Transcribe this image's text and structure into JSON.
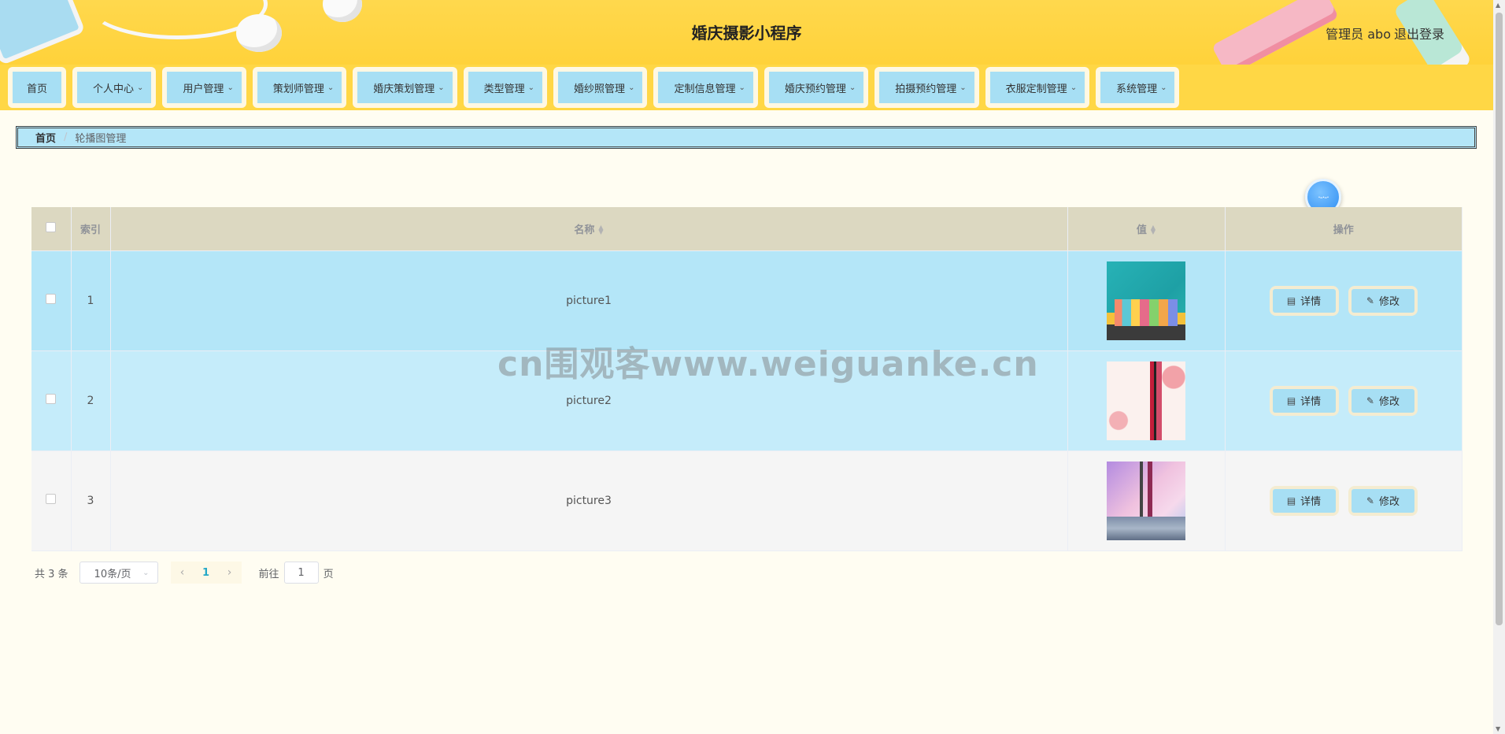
{
  "header": {
    "title": "婚庆摄影小程序",
    "user": "管理员 abo",
    "logout": "退出登录"
  },
  "nav": {
    "items": [
      {
        "label": "首页",
        "has_dropdown": false
      },
      {
        "label": "个人中心",
        "has_dropdown": true
      },
      {
        "label": "用户管理",
        "has_dropdown": true
      },
      {
        "label": "策划师管理",
        "has_dropdown": true
      },
      {
        "label": "婚庆策划管理",
        "has_dropdown": true
      },
      {
        "label": "类型管理",
        "has_dropdown": true
      },
      {
        "label": "婚纱照管理",
        "has_dropdown": true
      },
      {
        "label": "定制信息管理",
        "has_dropdown": true
      },
      {
        "label": "婚庆预约管理",
        "has_dropdown": true
      },
      {
        "label": "拍摄预约管理",
        "has_dropdown": true
      },
      {
        "label": "衣服定制管理",
        "has_dropdown": true
      },
      {
        "label": "系统管理",
        "has_dropdown": true
      }
    ]
  },
  "breadcrumb": {
    "home": "首页",
    "separator": "/",
    "current": "轮播图管理"
  },
  "table": {
    "headers": {
      "index": "索引",
      "name": "名称",
      "value": "值",
      "actions": "操作"
    },
    "rows": [
      {
        "index": "1",
        "name": "picture1",
        "image": "teal city illustration"
      },
      {
        "index": "2",
        "name": "picture2",
        "image": "red lipstick with floral pattern"
      },
      {
        "index": "3",
        "name": "picture3",
        "image": "pink purple city photo"
      }
    ],
    "detail_label": "详情",
    "edit_label": "修改"
  },
  "pagination": {
    "total": "共 3 条",
    "page_size": "10条/页",
    "current_page": "1",
    "goto_prefix": "前往",
    "goto_value": "1",
    "goto_suffix": "页"
  },
  "watermark": "cn围观客www.weiguanke.cn",
  "colors": {
    "header_bg": "#ffd23a",
    "nav_button": "#a7dff4",
    "breadcrumb_bg": "#b4e6f8",
    "table_header": "#dcd8c1",
    "row_highlight": "#b4e6f8",
    "page_bg": "#fffdf2"
  }
}
